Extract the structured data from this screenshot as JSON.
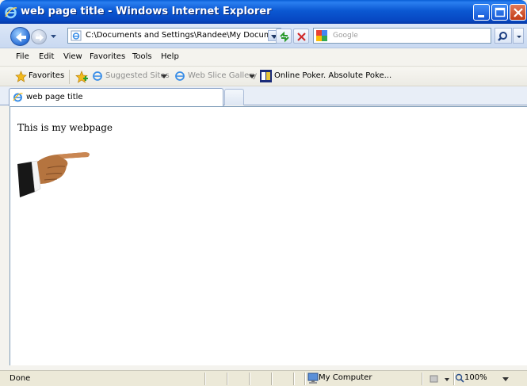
{
  "window": {
    "title": "web page title - Windows Internet Explorer"
  },
  "address_bar": {
    "url": "C:\\Documents and Settings\\Randee\\My Documents",
    "search_placeholder": "Google"
  },
  "menu": {
    "items": [
      "File",
      "Edit",
      "View",
      "Favorites",
      "Tools",
      "Help"
    ]
  },
  "favorites_bar": {
    "favorites_label": "Favorites",
    "suggested_sites": "Suggested Sites",
    "web_slice_gallery": "Web Slice Gallery",
    "online_poker": "Online Poker. Absolute Poke..."
  },
  "tabs": {
    "active_label": "web page title"
  },
  "page": {
    "text": "This is my webpage"
  },
  "status_bar": {
    "status": "Done",
    "zone": "My Computer",
    "zoom": "100%"
  },
  "colors": {
    "titlebar": "#0b58d2",
    "chrome": "#f4f3ee",
    "content_bg": "#ffffff"
  }
}
